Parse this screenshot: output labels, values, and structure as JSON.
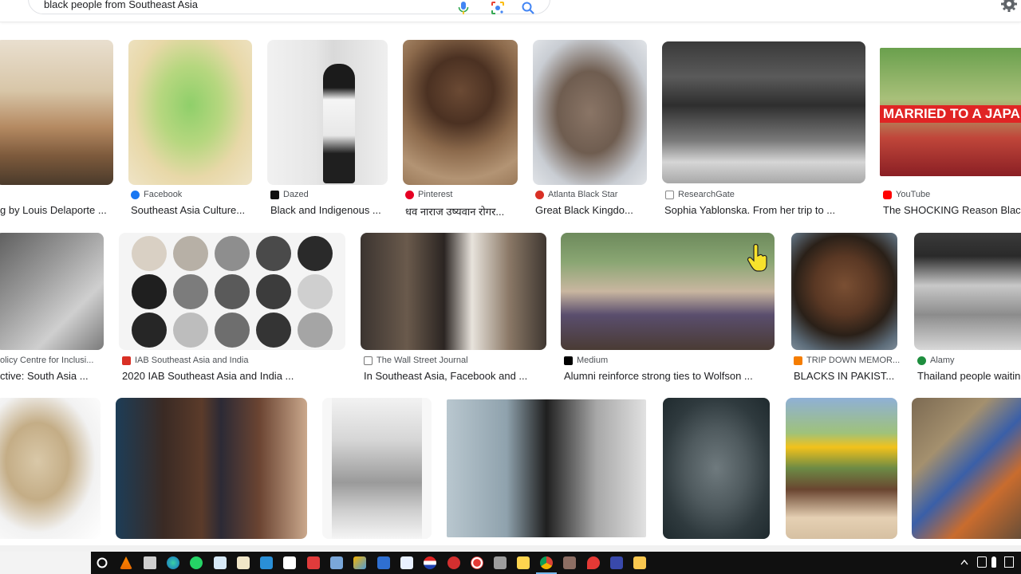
{
  "search": {
    "query": "black people from Southeast Asia"
  },
  "icons": {
    "mic": "microphone-icon",
    "lens": "google-lens-icon",
    "search": "search-icon",
    "settings": "gear-icon"
  },
  "colors": {
    "accent": "#1a73e8",
    "title_text": "#202124",
    "source_text": "#4d5156",
    "taskbar": "#101010"
  },
  "results": {
    "row1": [
      {
        "source": "",
        "title": "g by Louis Delaporte ..."
      },
      {
        "source": "Facebook",
        "title": "Southeast Asia Culture..."
      },
      {
        "source": "Dazed",
        "title": "Black and Indigenous ..."
      },
      {
        "source": "Pinterest",
        "title": "धव नाराज उष्यवान रोगर..."
      },
      {
        "source": "Atlanta Black Star",
        "title": "Great Black Kingdo..."
      },
      {
        "source": "ResearchGate",
        "title": "Sophia Yablonska. From her trip to ..."
      },
      {
        "source": "YouTube",
        "title": "The SHOCKING Reason Black"
      }
    ],
    "row2": [
      {
        "source": "olicy Centre for Inclusi...",
        "title": "ctive: South Asia ..."
      },
      {
        "source": "IAB Southeast Asia and India",
        "title": "2020 IAB Southeast Asia and India ..."
      },
      {
        "source": "The Wall Street Journal",
        "title": "In Southeast Asia, Facebook and ..."
      },
      {
        "source": "Medium",
        "title": "Alumni reinforce strong ties to Wolfson ..."
      },
      {
        "source": "TRIP DOWN MEMOR...",
        "title": "BLACKS IN PAKIST..."
      },
      {
        "source": "Alamy",
        "title": "Thailand people waitin"
      }
    ],
    "overlays": {
      "youtube_banner": "MARRIED TO A JAPANESE"
    }
  }
}
